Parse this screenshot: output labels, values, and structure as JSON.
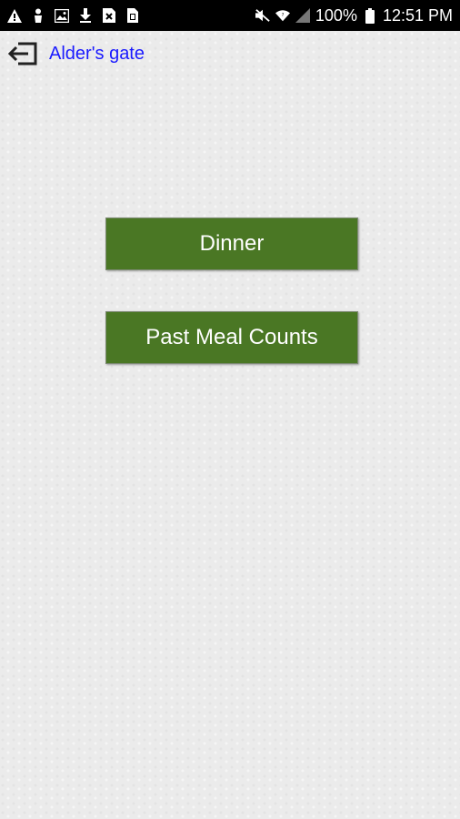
{
  "status_bar": {
    "battery": "100%",
    "time": "12:51 PM",
    "left_icons": [
      "warning-icon",
      "person-icon",
      "image-icon",
      "download-icon",
      "close-box-icon",
      "sim-icon"
    ],
    "right_icons": [
      "mute-icon",
      "wifi-icon",
      "signal-icon",
      "battery-icon"
    ]
  },
  "header": {
    "title": "Alder's gate",
    "back_icon": "exit-icon"
  },
  "menu": {
    "dinner_label": "Dinner",
    "past_meal_counts_label": "Past Meal Counts"
  },
  "colors": {
    "button_bg": "#4a7724",
    "title_link": "#1a1aff",
    "status_bar_bg": "#000000"
  }
}
